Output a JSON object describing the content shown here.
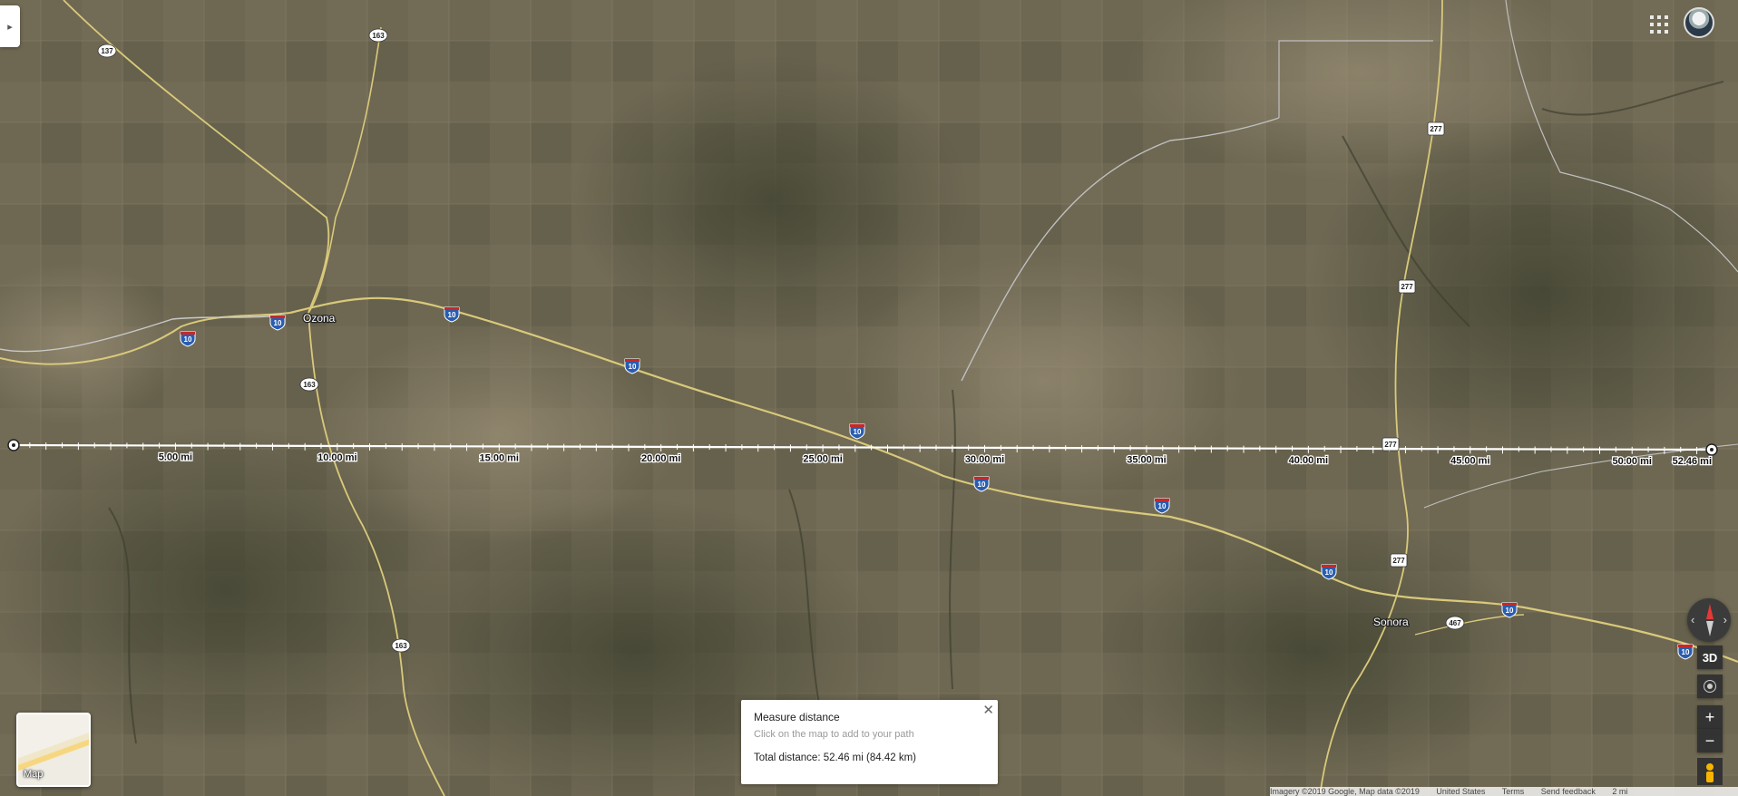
{
  "map": {
    "type": "satellite",
    "places": [
      {
        "name": "Ozona"
      },
      {
        "name": "Sonora"
      }
    ],
    "highway_labels": {
      "interstate": "10",
      "us": [
        "277"
      ],
      "state": [
        "137",
        "163",
        "467"
      ]
    },
    "scale_ticks": [
      "5.00 mi",
      "10.00 mi",
      "15.00 mi",
      "20.00 mi",
      "25.00 mi",
      "30.00 mi",
      "35.00 mi",
      "40.00 mi",
      "45.00 mi",
      "50.00 mi",
      "52.46 mi"
    ]
  },
  "measure": {
    "title": "Measure distance",
    "hint": "Click on the map to add to your path",
    "total": "Total distance: 52.46 mi (84.42 km)",
    "close_glyph": "✕"
  },
  "controls": {
    "btn_3d": "3D",
    "zoom_in": "+",
    "zoom_out": "−",
    "compass_left": "‹",
    "compass_right": "›",
    "collapse_glyph": "▸"
  },
  "layer": {
    "label": "Map"
  },
  "footer": {
    "imagery": "Imagery ©2019 Google, Map data ©2019",
    "region": "United States",
    "terms": "Terms",
    "feedback": "Send feedback",
    "scale": "2 mi"
  },
  "colors": {
    "terrain_base": "#6b6551",
    "interstate_shield": "#2a5db0",
    "measure_line": "#ffffff"
  },
  "icons": [
    "apps-grid-icon",
    "account-avatar-icon",
    "compass-icon",
    "my-location-icon",
    "pegman-icon",
    "close-icon",
    "collapse-arrow-icon"
  ]
}
